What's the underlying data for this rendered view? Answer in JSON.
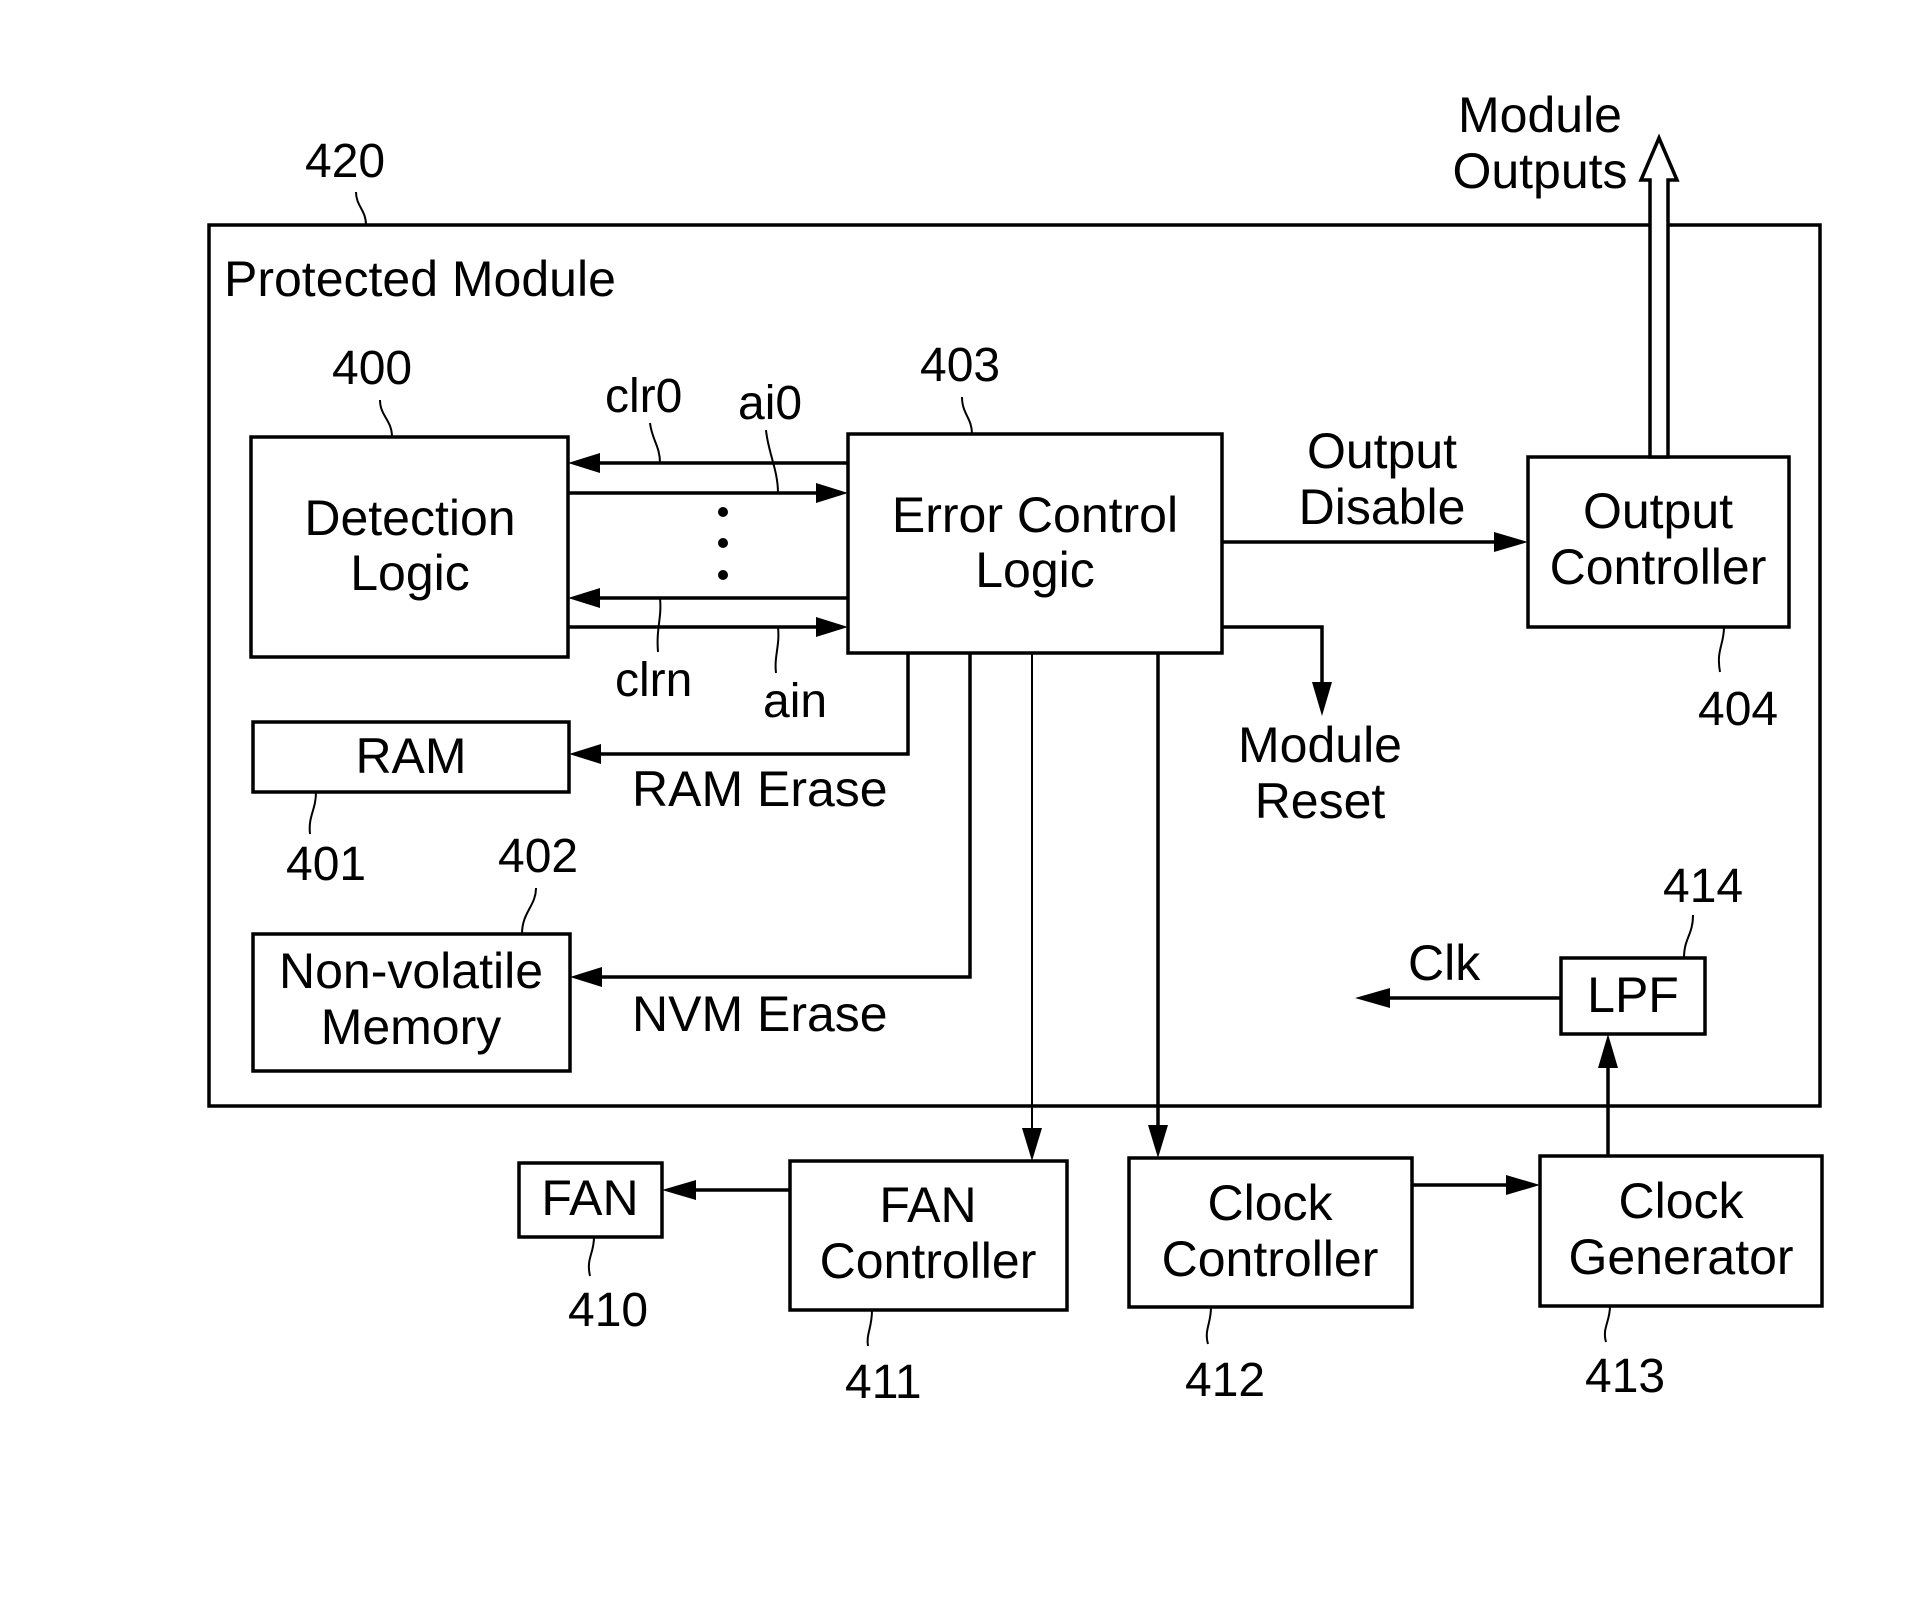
{
  "diagram": {
    "container": {
      "label": "Protected Module",
      "ref": "420"
    },
    "blocks": {
      "detection_logic": {
        "lines": [
          "Detection",
          "Logic"
        ],
        "ref": "400"
      },
      "ram": {
        "lines": [
          "RAM"
        ],
        "ref": "401"
      },
      "nvm": {
        "lines": [
          "Non-volatile",
          "Memory"
        ],
        "ref": "402"
      },
      "error_control_logic": {
        "lines": [
          "Error Control",
          "Logic"
        ],
        "ref": "403"
      },
      "output_controller": {
        "lines": [
          "Output",
          "Controller"
        ],
        "ref": "404"
      },
      "fan": {
        "lines": [
          "FAN"
        ],
        "ref": "410"
      },
      "fan_controller": {
        "lines": [
          "FAN",
          "Controller"
        ],
        "ref": "411"
      },
      "clock_controller": {
        "lines": [
          "Clock",
          "Controller"
        ],
        "ref": "412"
      },
      "clock_generator": {
        "lines": [
          "Clock",
          "Generator"
        ],
        "ref": "413"
      },
      "lpf": {
        "lines": [
          "LPF"
        ],
        "ref": "414"
      }
    },
    "signals": {
      "clr0": "clr0",
      "ai0": "ai0",
      "clrn": "clrn",
      "ain": "ain",
      "ram_erase": "RAM Erase",
      "nvm_erase": "NVM Erase",
      "output_disable": [
        "Output",
        "Disable"
      ],
      "module_reset": [
        "Module",
        "Reset"
      ],
      "module_outputs": [
        "Module",
        "Outputs"
      ],
      "clk": "Clk"
    }
  }
}
